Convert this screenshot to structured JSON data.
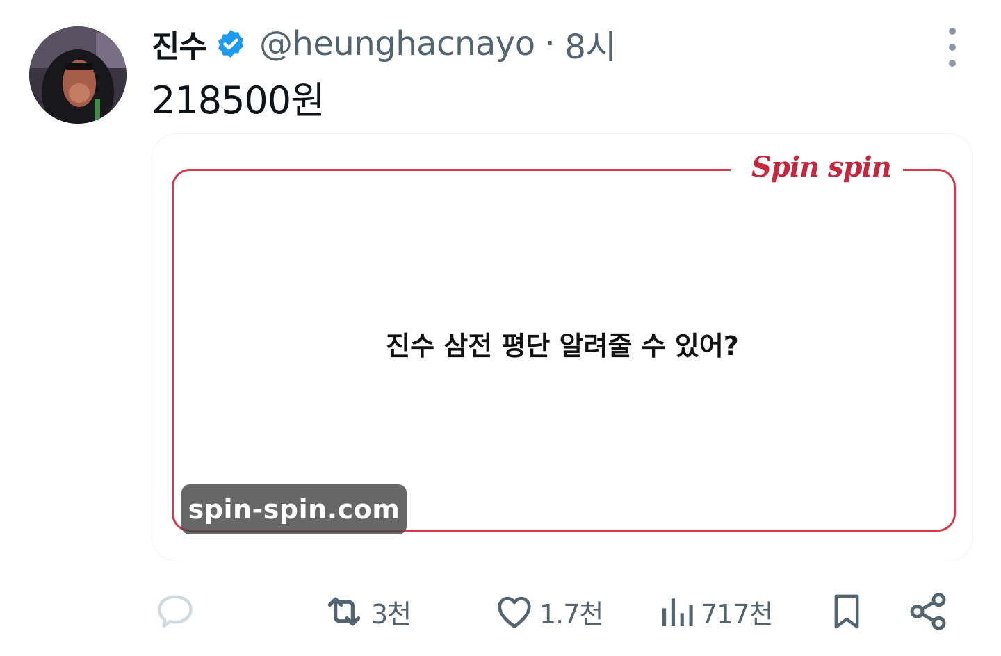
{
  "tweet": {
    "display_name": "진수",
    "handle": "@heunghacnayo",
    "separator": "·",
    "time": "8시",
    "text": "218500원",
    "verified_icon": "verified-badge-icon",
    "more_icon": "more-vertical-icon"
  },
  "media": {
    "brand": "Spin spin",
    "question": "진수 삼전 평단 알려줄 수 있어?",
    "watermark": "spin-spin.com",
    "frame_color": "#d23a4e",
    "brand_color": "#c8263c"
  },
  "actions": {
    "reply_icon": "reply-icon",
    "retweet_icon": "retweet-icon",
    "retweet_count": "3천",
    "like_icon": "heart-icon",
    "like_count": "1.7천",
    "views_icon": "views-chart-icon",
    "views_count": "717천",
    "bookmark_icon": "bookmark-icon",
    "share_icon": "share-icon"
  },
  "colors": {
    "primary_text": "#0f1419",
    "secondary_text": "#536471",
    "verified": "#1d9bf0"
  }
}
